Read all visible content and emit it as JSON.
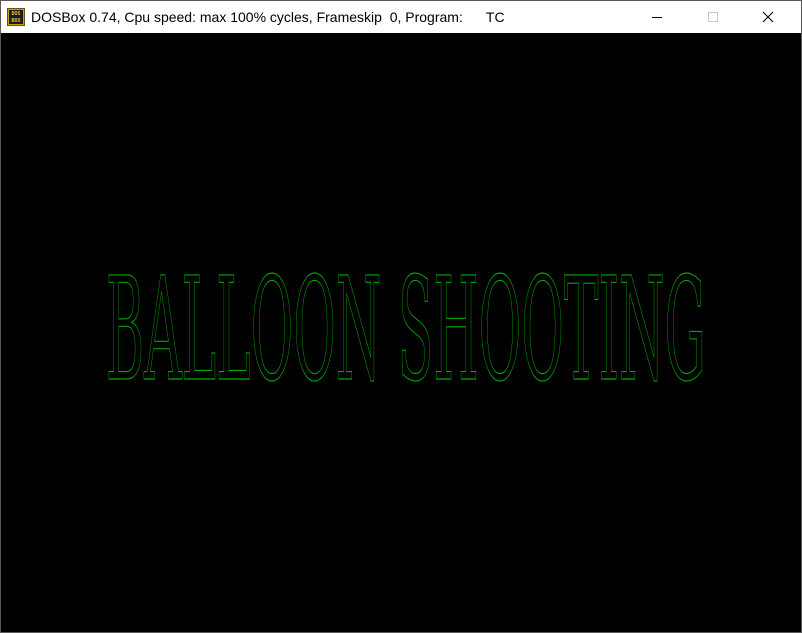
{
  "window": {
    "title": "DOSBox 0.74, Cpu speed: max 100% cycles, Frameskip  0, Program:      TC",
    "icon": "dosbox-icon",
    "icon_text": "DOS BOX",
    "controls": {
      "minimize": "minimize-icon",
      "maximize": "maximize-icon",
      "close": "close-icon"
    }
  },
  "screen": {
    "background": "#000000",
    "game_title": "BALLOON SHOOTING",
    "title_color": "#00a800"
  }
}
